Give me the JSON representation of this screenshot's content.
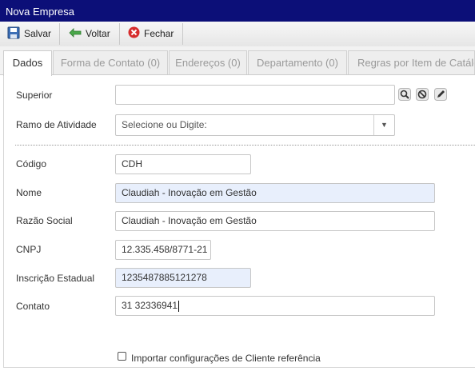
{
  "window": {
    "title": "Nova Empresa"
  },
  "toolbar": {
    "save_label": "Salvar",
    "back_label": "Voltar",
    "close_label": "Fechar"
  },
  "tabs": [
    {
      "label": "Dados"
    },
    {
      "label": "Forma de Contato (0)"
    },
    {
      "label": "Endereços (0)"
    },
    {
      "label": "Departamento (0)"
    },
    {
      "label": "Regras por Item de Catálogo"
    }
  ],
  "form": {
    "superior": {
      "label": "Superior",
      "value": ""
    },
    "ramo": {
      "label": "Ramo de Atividade",
      "placeholder": "Selecione ou Digite:"
    },
    "codigo": {
      "label": "Código",
      "value": "CDH"
    },
    "nome": {
      "label": "Nome",
      "value": "Claudiah - Inovação em Gestão"
    },
    "razao_social": {
      "label": "Razão Social",
      "value": "Claudiah - Inovação em Gestão"
    },
    "cnpj": {
      "label": "CNPJ",
      "value": "12.335.458/8771-21"
    },
    "inscricao": {
      "label": "Inscrição Estadual",
      "value": "1235487885121278"
    },
    "contato": {
      "label": "Contato",
      "value": "31 32336941"
    },
    "importar": {
      "label": "Importar configurações de Cliente referência",
      "checked": false
    }
  }
}
